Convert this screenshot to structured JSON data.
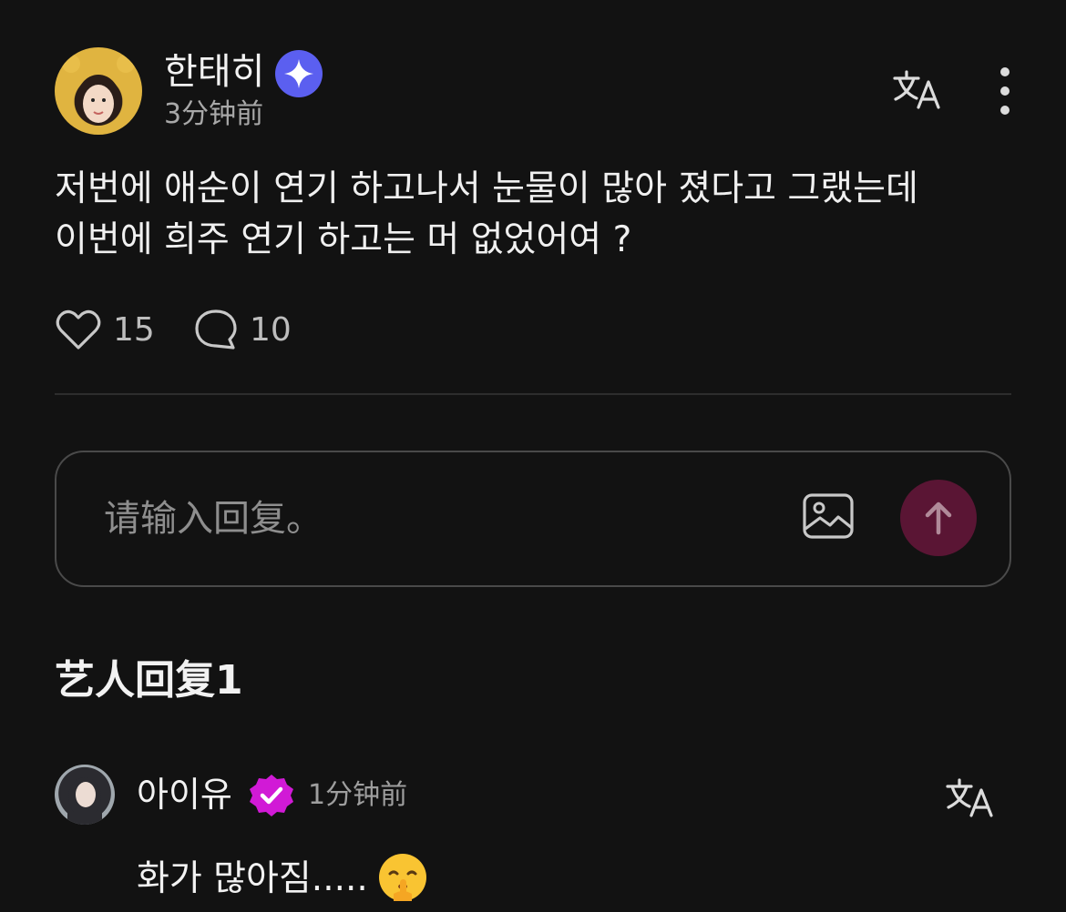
{
  "post": {
    "username": "한태히",
    "time": "3分钟前",
    "lines": [
      "저번에 애순이 연기 하고나서 눈물이 많아 졌다고 그랬는데",
      "이번에 희주 연기 하고는 머 없었어여 ?"
    ],
    "likes": "15",
    "comments": "10"
  },
  "reply_box": {
    "placeholder": "请输入回复。"
  },
  "artist_replies": {
    "title": "艺人回复1",
    "items": [
      {
        "username": "아이유",
        "time": "1分钟前",
        "text": "화가 많아짐.....",
        "emoji": "shushing-face-icon"
      }
    ]
  },
  "colors": {
    "background": "#121212",
    "verified_blue": "#5b5ff0",
    "verified_pink": "#d11ad6",
    "send_button": "#5a1534"
  }
}
